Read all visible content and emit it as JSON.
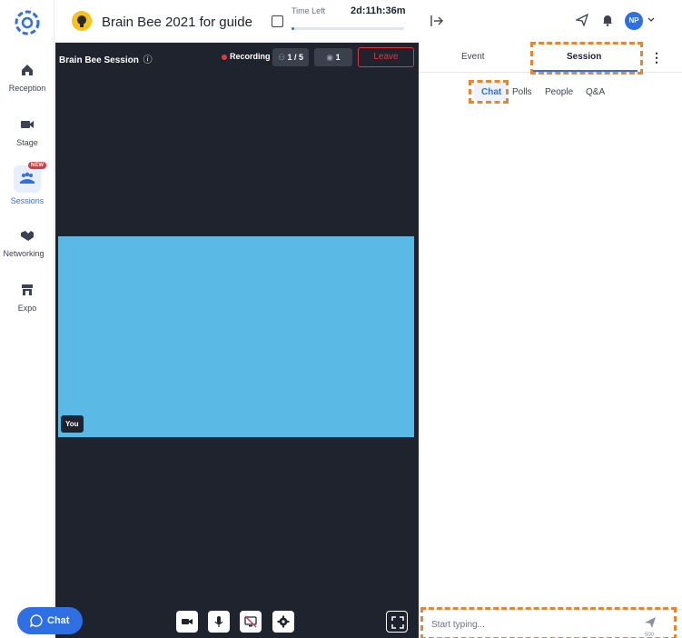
{
  "event": {
    "title": "Brain Bee 2021 for guide",
    "time_left_label": "Time Left",
    "time_left_value": "2d:11h:36m"
  },
  "nav": {
    "items": [
      {
        "label": "Reception",
        "icon": "home-icon"
      },
      {
        "label": "Stage",
        "icon": "video-icon"
      },
      {
        "label": "Sessions",
        "icon": "sessions-icon",
        "badge": "NEW",
        "active": true
      },
      {
        "label": "Networking",
        "icon": "handshake-icon"
      },
      {
        "label": "Expo",
        "icon": "store-icon"
      }
    ]
  },
  "stage": {
    "session_name": "Brain Bee Session",
    "recording_label": "Recording",
    "participants": "1 / 5",
    "viewers": "1",
    "leave_label": "Leave",
    "tile_label": "You"
  },
  "chat_fab": {
    "label": "Chat"
  },
  "panel": {
    "avatar_initials": "NP",
    "tabs": [
      "Event",
      "Session"
    ],
    "active_tab": "Session",
    "sub_tabs": [
      "Chat",
      "Polls",
      "People",
      "Q&A"
    ],
    "active_sub_tab": "Chat",
    "input_placeholder": "Start typing...",
    "char_limit": "500"
  },
  "colors": {
    "accent": "#2f6fe4",
    "stage_bg": "#1f232e",
    "video_tile": "#5bb9e5",
    "highlight": "#e8852e",
    "danger": "#e0373f"
  }
}
